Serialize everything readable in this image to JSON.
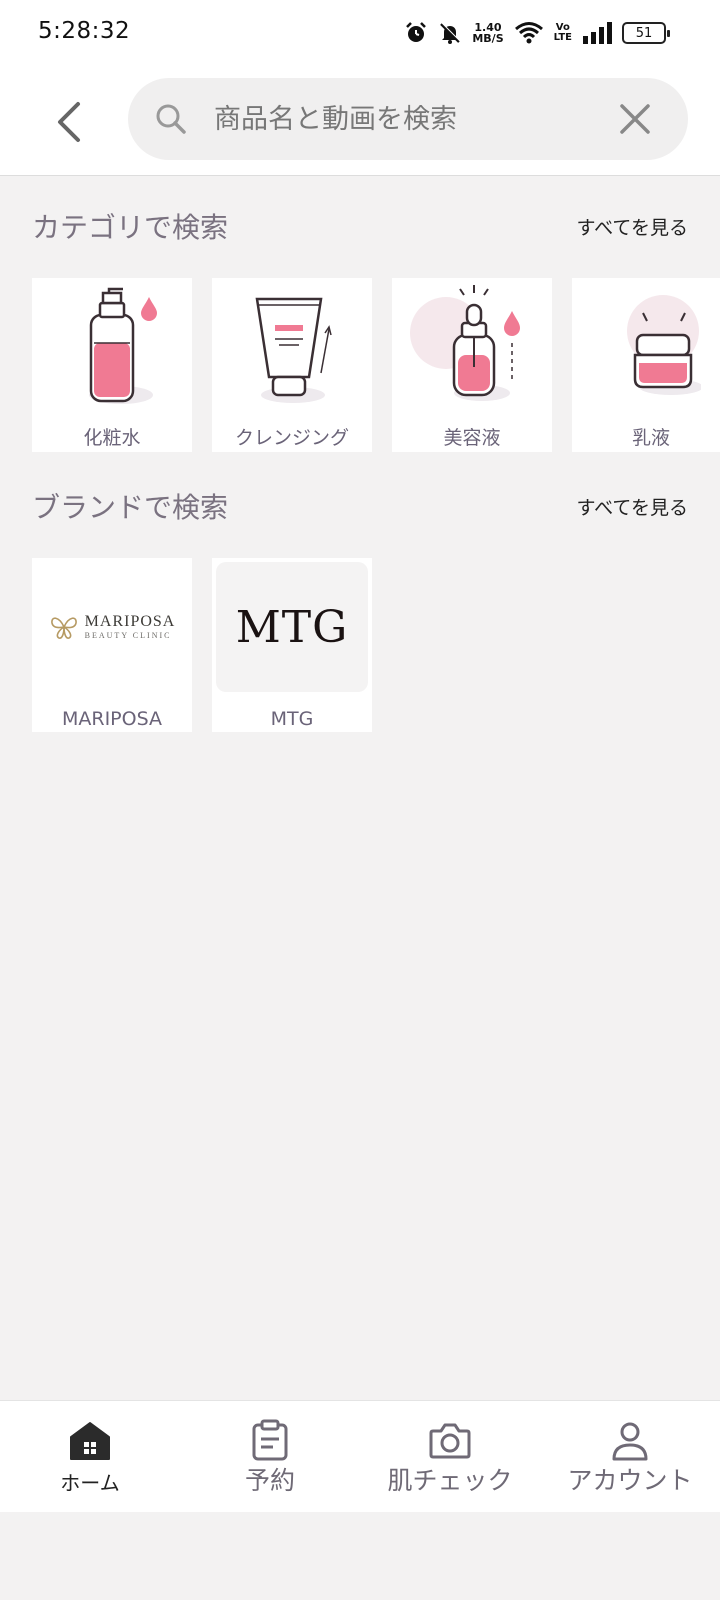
{
  "status_bar": {
    "time": "5:28:32",
    "net_speed_value": "1.40",
    "net_speed_unit": "MB/S",
    "volte_top": "Vo",
    "volte_bottom": "LTE",
    "battery": "51"
  },
  "search": {
    "placeholder": "商品名と動画を検索"
  },
  "category_section": {
    "title": "カテゴリで検索",
    "see_all": "すべてを見る",
    "items": [
      {
        "label": "化粧水",
        "icon": "toner-bottle-icon"
      },
      {
        "label": "クレンジング",
        "icon": "cleansing-tube-icon"
      },
      {
        "label": "美容液",
        "icon": "serum-dropper-icon"
      },
      {
        "label": "乳液",
        "icon": "emulsion-jar-icon"
      }
    ]
  },
  "brand_section": {
    "title": "ブランドで検索",
    "see_all": "すべてを見る",
    "items": [
      {
        "label": "MARIPOSA",
        "logo_name": "MARIPOSA",
        "logo_sub": "BEAUTY CLINIC"
      },
      {
        "label": "MTG",
        "logo_name": "MTG"
      }
    ]
  },
  "bottom_nav": {
    "items": [
      {
        "label": "ホーム",
        "icon": "home-icon",
        "active": true
      },
      {
        "label": "予約",
        "icon": "clipboard-icon"
      },
      {
        "label": "肌チェック",
        "icon": "camera-icon"
      },
      {
        "label": "アカウント",
        "icon": "user-icon"
      }
    ]
  },
  "colors": {
    "accent_pink": "#f07a93",
    "section_title": "#7a7280",
    "background": "#f3f2f2"
  }
}
